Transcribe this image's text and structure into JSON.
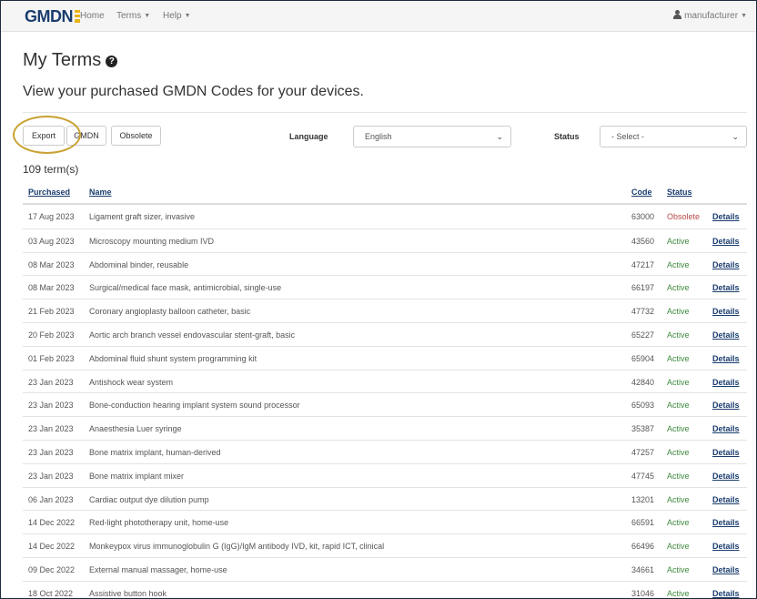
{
  "navbar": {
    "brand": "GMDN",
    "items": [
      {
        "label": "Home",
        "dropdown": false
      },
      {
        "label": "Terms",
        "dropdown": true
      },
      {
        "label": "Help",
        "dropdown": true
      }
    ],
    "user": "manufacturer"
  },
  "page": {
    "title": "My Terms",
    "subtitle": "View your purchased GMDN Codes for your devices."
  },
  "toolbar": {
    "export_label": "Export",
    "gmdn_label": "GMDN",
    "obsolete_label": "Obsolete",
    "language_label": "Language",
    "language_value": "English",
    "status_label": "Status",
    "status_value": "- Select -"
  },
  "count_text": "109 term(s)",
  "table": {
    "headers": {
      "purchased": "Purchased",
      "name": "Name",
      "code": "Code",
      "status": "Status"
    },
    "rows": [
      {
        "purchased": "17 Aug 2023",
        "name": "Ligament graft sizer, invasive",
        "code": "63000",
        "status": "Obsolete",
        "details": "Details"
      },
      {
        "purchased": "03 Aug 2023",
        "name": "Microscopy mounting medium IVD",
        "code": "43560",
        "status": "Active",
        "details": "Details"
      },
      {
        "purchased": "08 Mar 2023",
        "name": "Abdominal binder, reusable",
        "code": "47217",
        "status": "Active",
        "details": "Details"
      },
      {
        "purchased": "08 Mar 2023",
        "name": "Surgical/medical face mask, antimicrobial, single-use",
        "code": "66197",
        "status": "Active",
        "details": "Details"
      },
      {
        "purchased": "21 Feb 2023",
        "name": "Coronary angioplasty balloon catheter, basic",
        "code": "47732",
        "status": "Active",
        "details": "Details"
      },
      {
        "purchased": "20 Feb 2023",
        "name": "Aortic arch branch vessel endovascular stent-graft, basic",
        "code": "65227",
        "status": "Active",
        "details": "Details"
      },
      {
        "purchased": "01 Feb 2023",
        "name": "Abdominal fluid shunt system programming kit",
        "code": "65904",
        "status": "Active",
        "details": "Details"
      },
      {
        "purchased": "23 Jan 2023",
        "name": "Antishock wear system",
        "code": "42840",
        "status": "Active",
        "details": "Details"
      },
      {
        "purchased": "23 Jan 2023",
        "name": "Bone-conduction hearing implant system sound processor",
        "code": "65093",
        "status": "Active",
        "details": "Details"
      },
      {
        "purchased": "23 Jan 2023",
        "name": "Anaesthesia Luer syringe",
        "code": "35387",
        "status": "Active",
        "details": "Details"
      },
      {
        "purchased": "23 Jan 2023",
        "name": "Bone matrix implant, human-derived",
        "code": "47257",
        "status": "Active",
        "details": "Details"
      },
      {
        "purchased": "23 Jan 2023",
        "name": "Bone matrix implant mixer",
        "code": "47745",
        "status": "Active",
        "details": "Details"
      },
      {
        "purchased": "06 Jan 2023",
        "name": "Cardiac output dye dilution pump",
        "code": "13201",
        "status": "Active",
        "details": "Details"
      },
      {
        "purchased": "14 Dec 2022",
        "name": "Red-light phototherapy unit, home-use",
        "code": "66591",
        "status": "Active",
        "details": "Details"
      },
      {
        "purchased": "14 Dec 2022",
        "name": "Monkeypox virus immunoglobulin G (IgG)/IgM antibody IVD, kit, rapid ICT, clinical",
        "code": "66496",
        "status": "Active",
        "details": "Details"
      },
      {
        "purchased": "09 Dec 2022",
        "name": "External manual massager, home-use",
        "code": "34661",
        "status": "Active",
        "details": "Details"
      },
      {
        "purchased": "18 Oct 2022",
        "name": "Assistive button hook",
        "code": "31046",
        "status": "Active",
        "details": "Details"
      }
    ]
  },
  "colors": {
    "brand": "#1a3d6e",
    "active": "#3e8a3e",
    "obsolete": "#b94a48",
    "highlight_ring": "#c9a233"
  }
}
